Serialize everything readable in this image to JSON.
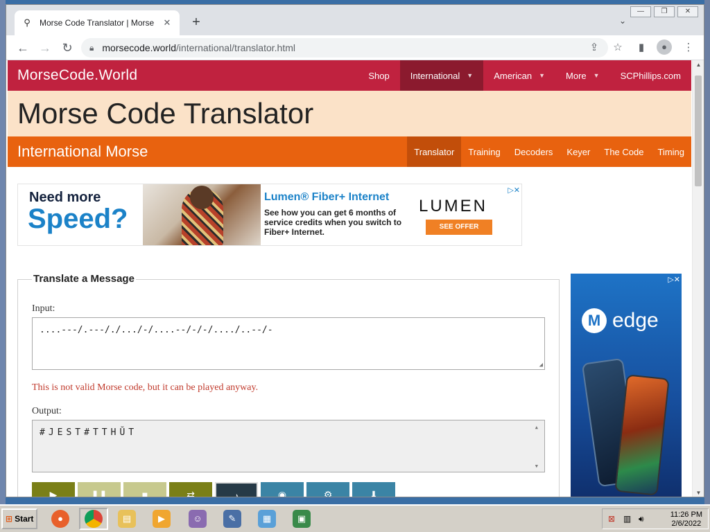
{
  "browser": {
    "tab_title": "Morse Code Translator | Morse Code World",
    "url_host": "morsecode.world",
    "url_path": "/international/translator.html"
  },
  "site": {
    "brand": "MorseCode.World",
    "nav": [
      "Shop",
      "International",
      "American",
      "More",
      "SCPhillips.com"
    ],
    "page_title": "Morse Code Translator",
    "subbrand": "International Morse",
    "subnav": [
      "Translator",
      "Training",
      "Decoders",
      "Keyer",
      "The Code",
      "Timing"
    ]
  },
  "ad_banner": {
    "need": "Need more",
    "speed": "Speed?",
    "headline": "Lumen® Fiber+ Internet",
    "copy": "See how you can get 6 months of service credits when you switch to Fiber+ Internet.",
    "logo": "LUMEN",
    "cta": "SEE OFFER"
  },
  "ad_side": {
    "brand": "edge"
  },
  "translator": {
    "legend": "Translate a Message",
    "input_label": "Input:",
    "input_value": "....---/.---/./.../-/....--/-/-/..../..--/-",
    "warning": "This is not valid Morse code, but it can be played anyway.",
    "output_label": "Output:",
    "output_value": "#JEST#TTHŬT"
  },
  "taskbar": {
    "start": "Start",
    "time": "11:26 PM",
    "date": "2/6/2022"
  },
  "colors": {
    "nav_red": "#c0223f",
    "nav_active": "#8b1a2e",
    "hero_bg": "#fbe2c8",
    "subnav_orange": "#e8620f",
    "warning_red": "#c0392b"
  }
}
